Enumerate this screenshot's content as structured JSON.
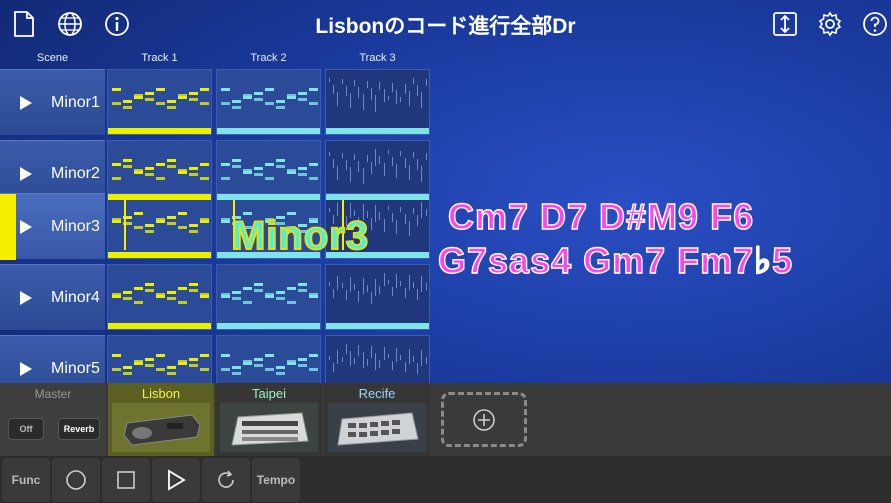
{
  "header": {
    "title": "Lisbonのコード進行全部Dr"
  },
  "icons": {
    "new": "document-icon",
    "web": "globe-icon",
    "info": "info-icon",
    "export": "export-icon",
    "settings": "gear-icon",
    "help": "help-icon"
  },
  "grid": {
    "columns": [
      "Scene",
      "Track 1",
      "Track 2",
      "Track 3"
    ],
    "scenes": [
      "Minor1",
      "Minor2",
      "Minor3",
      "Minor4",
      "Minor5"
    ],
    "selected_scene": "Minor3"
  },
  "overlay": {
    "big_label": "Minor3",
    "chords_line1": "Cm7   D7   D#M9   F6",
    "chords_line2": "G7sas4   Gm7   Fm7♭5"
  },
  "instruments": {
    "master_label": "Master",
    "off_label": "Off",
    "reverb_label": "Reverb",
    "items": [
      "Lisbon",
      "Taipei",
      "Recife"
    ]
  },
  "transport": {
    "func_label": "Func",
    "tempo_label": "Tempo"
  },
  "colors": {
    "selection": "#f6f000",
    "track1": "#eaf000",
    "track2": "#7fe3ea",
    "track3": "#9fd6ff",
    "chords": "#ff45ea",
    "big_label": "#3df0ff"
  }
}
